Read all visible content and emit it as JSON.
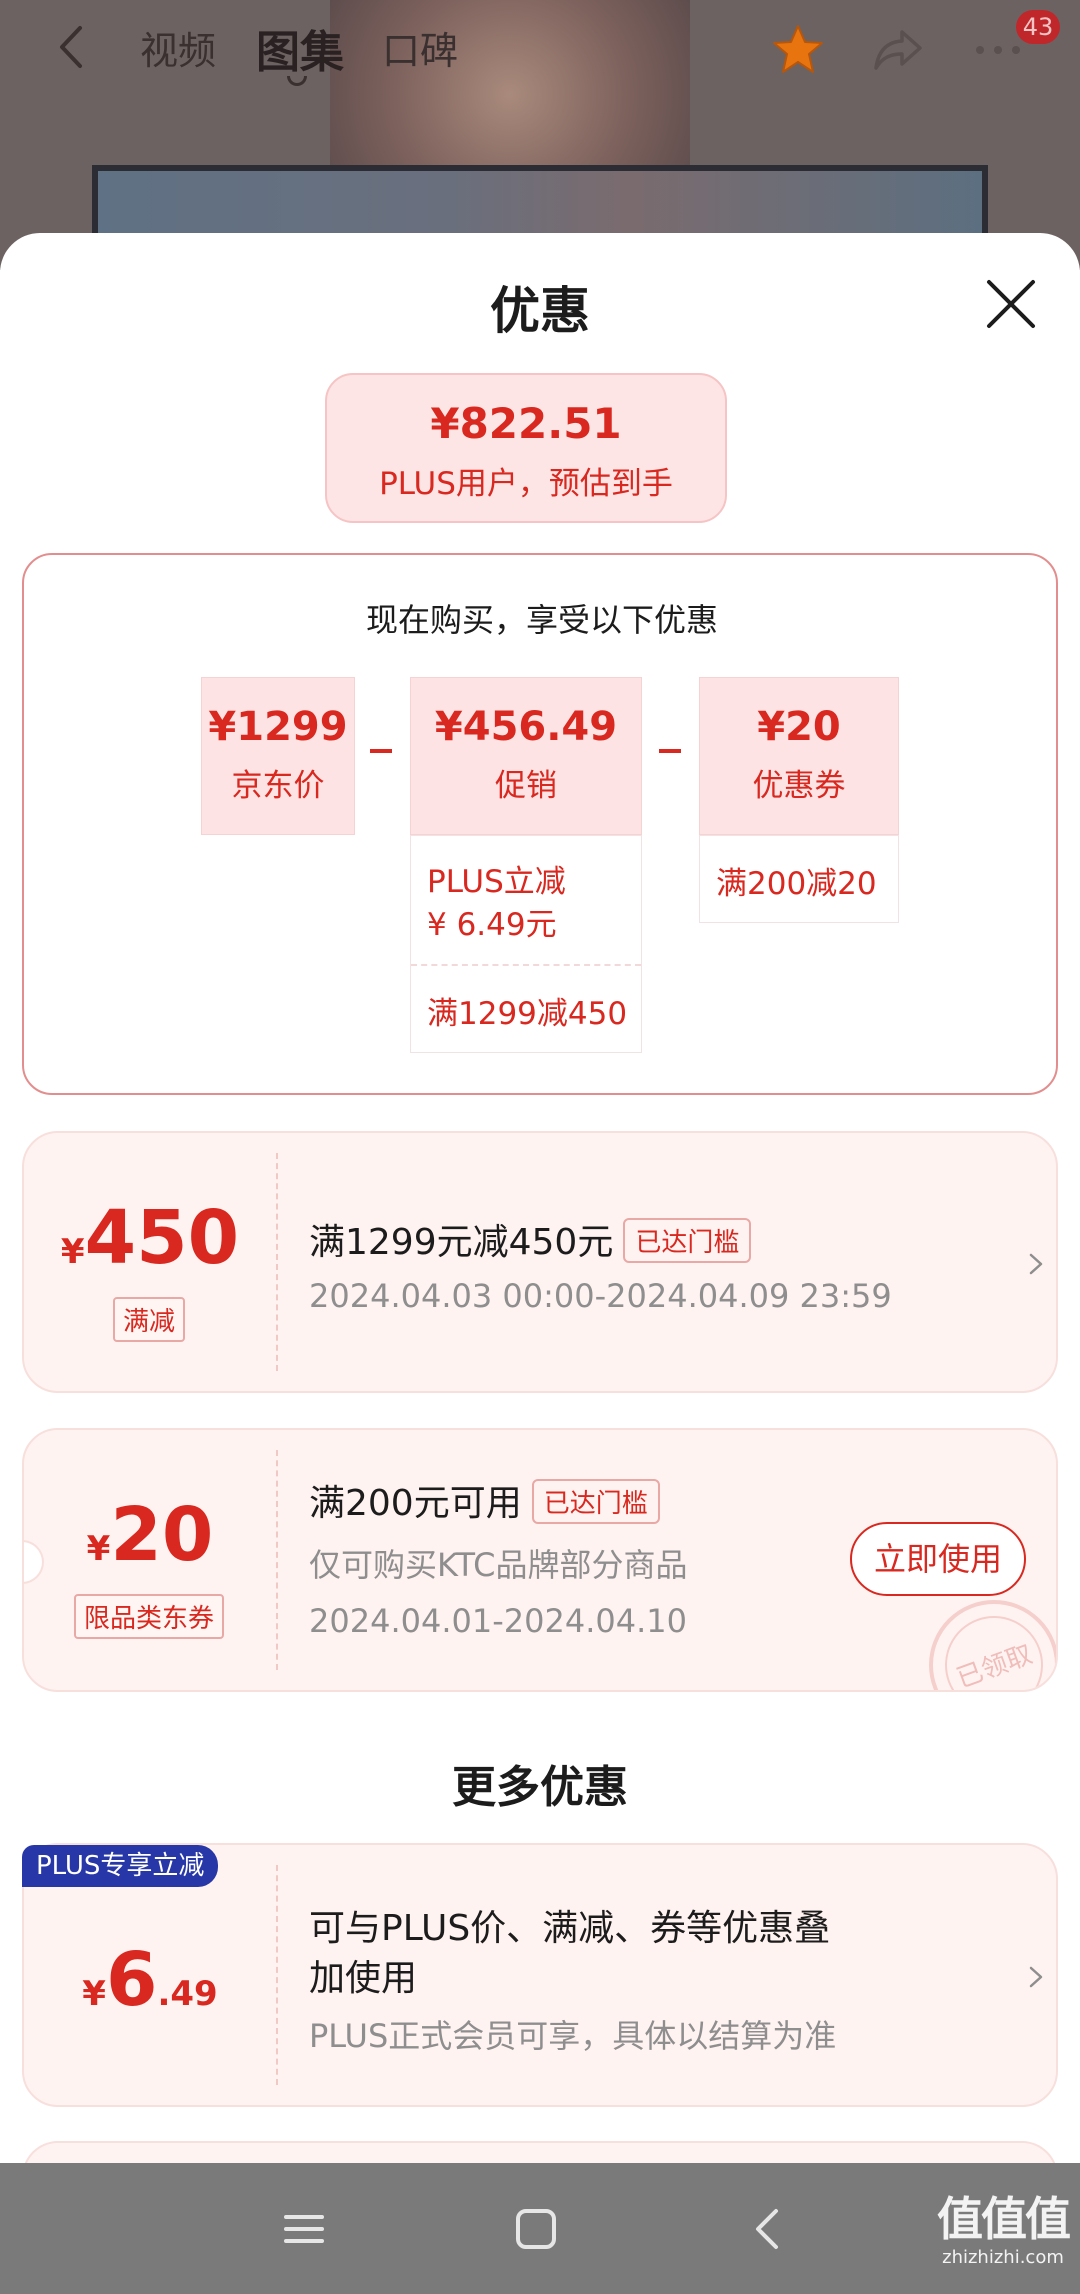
{
  "topnav": {
    "tabs": [
      {
        "label": "视频"
      },
      {
        "label": "图集"
      },
      {
        "label": "口碑"
      }
    ],
    "badge_count": "43",
    "icons": [
      "back-icon",
      "star-icon",
      "share-icon",
      "more-icon"
    ],
    "star_color": "#e8740f"
  },
  "sheet": {
    "title": "优惠",
    "estimate": {
      "price": "¥822.51",
      "label": "PLUS用户，预估到手"
    },
    "breakdown": {
      "title": "现在购买，享受以下优惠",
      "items": [
        {
          "value": "¥1299",
          "label": "京东价"
        },
        {
          "value": "¥456.49",
          "label": "促销",
          "details": [
            "PLUS立减",
            "¥ 6.49元",
            "满1299减450"
          ]
        },
        {
          "value": "¥20",
          "label": "优惠券",
          "details": [
            "满200减20"
          ]
        }
      ]
    },
    "coupons": [
      {
        "currency": "¥",
        "amount": "450",
        "type": "满减",
        "title": "满1299元减450元",
        "status": "已达门槛",
        "validity": "2024.04.03 00:00-2024.04.09 23:59"
      },
      {
        "currency": "¥",
        "amount": "20",
        "type": "限品类东券",
        "title": "满200元可用",
        "status": "已达门槛",
        "scope": "仅可购买KTC品牌部分商品",
        "validity": "2024.04.01-2024.04.10",
        "action": "立即使用",
        "stamp": "已领取"
      }
    ],
    "more": {
      "title": "更多优惠",
      "items": [
        {
          "tag": "PLUS专享立减",
          "currency": "¥",
          "amount_int": "6",
          "amount_dec": ".49",
          "title_line1": "可与PLUS价、满减、券等优惠叠",
          "title_line2": "加使用",
          "subtitle": "PLUS正式会员可享，具体以结算为准"
        }
      ]
    }
  },
  "sysbar": {
    "icons": [
      "menu-icon",
      "home-icon",
      "back-icon"
    ],
    "watermark_big": "值值值",
    "watermark_small": "zhizhizhi.com"
  },
  "colors": {
    "accent_red": "#d8281f",
    "plus_blue": "#2737a8",
    "card_bg": "#fff3f1"
  }
}
